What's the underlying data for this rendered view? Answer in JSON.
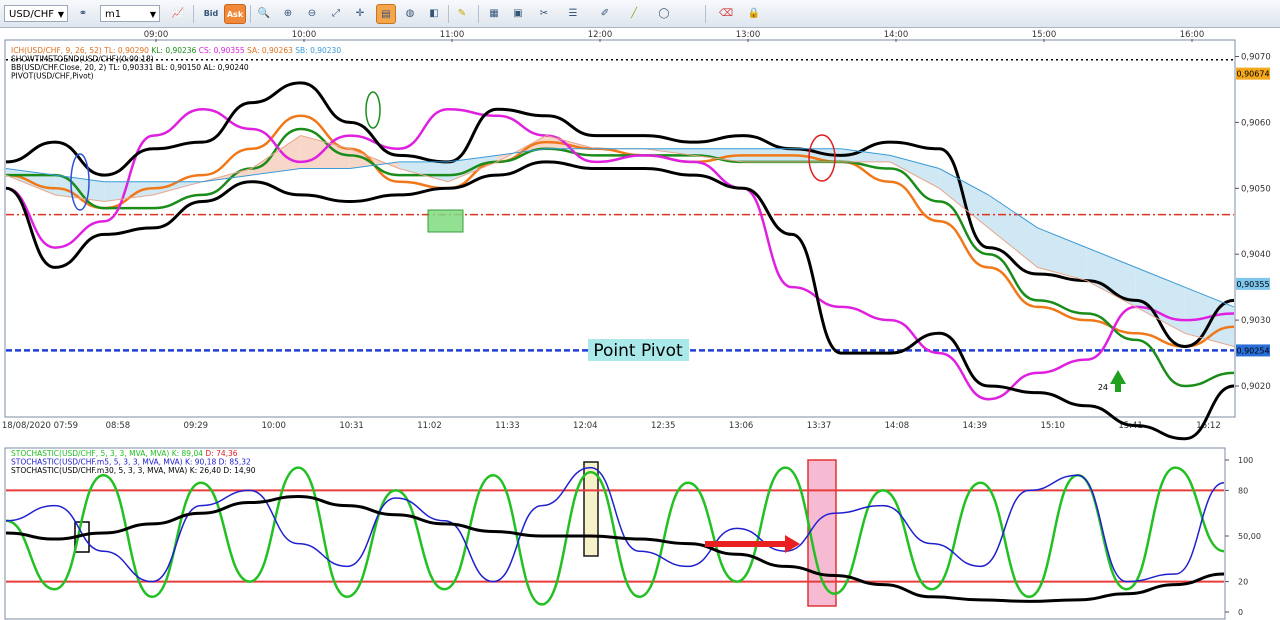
{
  "toolbar": {
    "symbol": "USD/CHF",
    "timeframe": "m1",
    "bid_label": "Bid",
    "ask_label": "Ask",
    "icons": [
      "link-icon",
      "chart-style-icon",
      "bid-ask-icon",
      "zoom-icon",
      "zoom-in-icon",
      "zoom-out-icon",
      "zoom-fit-icon",
      "crosshair-icon",
      "properties-icon",
      "globe-icon",
      "ruler-icon",
      "image-icon",
      "window-icon",
      "tools-icon",
      "lines-icon",
      "pen-icon",
      "line-icon",
      "ellipse-icon",
      "eraser-icon",
      "lock-icon"
    ]
  },
  "top_time_labels": [
    "09:00",
    "10:00",
    "11:00",
    "12:00",
    "13:00",
    "14:00",
    "15:00",
    "16:00"
  ],
  "bottom_time_labels": [
    "18/08/2020 07:59",
    "08:58",
    "09:29",
    "10:00",
    "10:31",
    "11:02",
    "11:33",
    "12:04",
    "12:35",
    "13:06",
    "13:37",
    "14:08",
    "14:39",
    "15:10",
    "15:41",
    "16:12"
  ],
  "price_labels": [
    "0,9070",
    "0,9060",
    "0,9050",
    "0,9040",
    "0,9030",
    "0,9020"
  ],
  "price_badges": [
    {
      "text": "0,90674",
      "color": "#f4a81c"
    },
    {
      "text": "0,90355",
      "color": "#7fc6ec"
    },
    {
      "text": "0,90254",
      "color": "#2a6fd8"
    }
  ],
  "indicator_legend": [
    {
      "segments": [
        {
          "text": "ICH(USD/CHF, 9, 26, 52)",
          "color": "#e07020"
        },
        {
          "text": "TL: 0,90290",
          "color": "#e07020"
        },
        {
          "text": "KL: 0,90236",
          "color": "#1a8c1a"
        },
        {
          "text": "CS: 0,90355",
          "color": "#e020e0"
        },
        {
          "text": "SA: 0,90263",
          "color": "#e07020"
        },
        {
          "text": "SB: 0,90230",
          "color": "#3a9ad6"
        }
      ]
    },
    {
      "segments": [
        {
          "text": "SHOWTIMETOEND(USD/CHF)(0:00:18)",
          "color": "#000000"
        }
      ]
    },
    {
      "segments": [
        {
          "text": "BB(USD/CHF.Close, 20, 2)  TL: 0,90331  BL: 0,90150  AL: 0,90240",
          "color": "#000000"
        }
      ]
    },
    {
      "segments": [
        {
          "text": "PIVOT(USD/CHF,Pivot)",
          "color": "#000000"
        }
      ]
    }
  ],
  "annotation_label": "Point Pivot",
  "arrow_label": "24",
  "stoch_legend": [
    {
      "segments": [
        {
          "text": "STOCHASTIC(USD/CHF, 5, 3, 3, MVA, MVA)",
          "color": "#22c022"
        },
        {
          "text": "K: 89,04",
          "color": "#22c022"
        },
        {
          "text": "D: 74,36",
          "color": "#e02020"
        }
      ]
    },
    {
      "segments": [
        {
          "text": "STOCHASTIC(USD/CHF.m5, 5, 3, 3, MVA, MVA)",
          "color": "#2020d0"
        },
        {
          "text": "K: 90,18",
          "color": "#2020d0"
        },
        {
          "text": "D: 85,32",
          "color": "#2020d0"
        }
      ]
    },
    {
      "segments": [
        {
          "text": "STOCHASTIC(USD/CHF.m30, 5, 3, 3, MVA, MVA)",
          "color": "#000000"
        },
        {
          "text": "K: 26,40",
          "color": "#000000"
        },
        {
          "text": "D: 14,90",
          "color": "#000000"
        }
      ]
    }
  ],
  "stoch_axis": [
    "100",
    "80",
    "50,00",
    "20",
    "0"
  ],
  "chart_data": {
    "type": "line",
    "symbol": "USD/CHF",
    "ylim": [
      0.90153,
      0.90725
    ],
    "x": [
      0,
      4,
      8,
      12,
      16,
      20,
      24,
      28,
      32,
      36,
      40,
      44,
      48,
      52,
      56,
      60,
      64,
      68,
      72,
      76,
      80,
      84,
      88,
      92,
      96,
      100
    ],
    "series": [
      {
        "name": "ICH TL",
        "color": "#f07818",
        "values": [
          0.9052,
          0.905,
          0.9047,
          0.905,
          0.9052,
          0.9056,
          0.9061,
          0.9056,
          0.9051,
          0.905,
          0.9054,
          0.9057,
          0.9056,
          0.9055,
          0.9054,
          0.9055,
          0.9055,
          0.9054,
          0.9051,
          0.9045,
          0.9038,
          0.9032,
          0.903,
          0.9028,
          0.9026,
          0.9029
        ]
      },
      {
        "name": "ICH KL",
        "color": "#1a8c1a",
        "values": [
          0.9052,
          0.9052,
          0.9047,
          0.9047,
          0.9049,
          0.9053,
          0.9059,
          0.9055,
          0.9052,
          0.9052,
          0.9054,
          0.9056,
          0.9055,
          0.9055,
          0.9055,
          0.9054,
          0.9054,
          0.9054,
          0.9053,
          0.9048,
          0.904,
          0.9033,
          0.9031,
          0.9027,
          0.902,
          0.9022
        ]
      },
      {
        "name": "ICH CS",
        "color": "#e020e0",
        "values": [
          0.905,
          0.9041,
          0.9045,
          0.9058,
          0.9062,
          0.9059,
          0.9054,
          0.9058,
          0.9056,
          0.9062,
          0.9061,
          0.9058,
          0.9054,
          0.9055,
          0.9054,
          0.905,
          0.9035,
          0.9032,
          0.903,
          0.9025,
          0.9018,
          0.9022,
          0.9024,
          0.9032,
          0.903,
          0.9031
        ]
      },
      {
        "name": "BB upper",
        "color": "#000000",
        "values": [
          0.9054,
          0.9057,
          0.9052,
          0.9056,
          0.9057,
          0.9063,
          0.9066,
          0.906,
          0.9055,
          0.9054,
          0.9062,
          0.9061,
          0.9058,
          0.9058,
          0.9057,
          0.9058,
          0.9056,
          0.9055,
          0.9057,
          0.9056,
          0.9041,
          0.9037,
          0.9036,
          0.9033,
          0.9026,
          0.9033
        ]
      },
      {
        "name": "BB lower",
        "color": "#000000",
        "values": [
          0.905,
          0.9038,
          0.9043,
          0.9044,
          0.9048,
          0.9051,
          0.9049,
          0.9048,
          0.9049,
          0.905,
          0.9052,
          0.9054,
          0.9053,
          0.9053,
          0.9052,
          0.905,
          0.9043,
          0.9025,
          0.9025,
          0.9028,
          0.902,
          0.9019,
          0.9017,
          0.9014,
          0.9012,
          0.902
        ]
      },
      {
        "name": "Senkou A",
        "color": "#e7a58a",
        "values": [
          0.9052,
          0.9049,
          0.9048,
          0.9049,
          0.9051,
          0.9053,
          0.9058,
          0.9056,
          0.9053,
          0.9051,
          0.9054,
          0.9058,
          0.9056,
          0.9056,
          0.9055,
          0.9054,
          0.9054,
          0.9054,
          0.9054,
          0.905,
          0.9044,
          0.9038,
          0.9036,
          0.9032,
          0.9028,
          0.9026
        ]
      },
      {
        "name": "Senkou B",
        "color": "#3a9ad6",
        "values": [
          0.9053,
          0.9052,
          0.9051,
          0.9051,
          0.9051,
          0.9052,
          0.9053,
          0.9053,
          0.9054,
          0.9054,
          0.9055,
          0.9056,
          0.9056,
          0.9056,
          0.9056,
          0.9056,
          0.9056,
          0.9056,
          0.9055,
          0.9053,
          0.9049,
          0.9044,
          0.9041,
          0.9038,
          0.9035,
          0.9032
        ]
      }
    ],
    "levels": [
      {
        "value": 0.90254,
        "color": "#1f3fd8",
        "style": "dashed"
      },
      {
        "value": 0.9046,
        "color": "#e03020",
        "style": "dashdot"
      },
      {
        "value": 0.90695,
        "color": "#000000",
        "style": "dotted"
      }
    ],
    "stochastic": {
      "ylim": [
        0,
        100
      ],
      "levels": [
        80,
        20
      ],
      "series": [
        {
          "name": "STOCHASTIC(USD/CHF, 5, 3, 3, MVA, MVA)",
          "color": "#22c022",
          "values": [
            60,
            15,
            90,
            10,
            85,
            20,
            95,
            10,
            80,
            15,
            90,
            5,
            92,
            10,
            85,
            20,
            95,
            12,
            80,
            15,
            85,
            10,
            90,
            15,
            95,
            40
          ]
        },
        {
          "name": "STOCHASTIC(USD/CHF.m5, 5, 3, 3, MVA, MVA)",
          "color": "#2020d0",
          "values": [
            60,
            70,
            40,
            20,
            70,
            80,
            45,
            30,
            75,
            60,
            20,
            70,
            95,
            40,
            30,
            55,
            40,
            65,
            70,
            45,
            30,
            80,
            90,
            20,
            25,
            85
          ]
        },
        {
          "name": "STOCHASTIC(USD/CHF.m30, 5, 3, 3, MVA, MVA)",
          "color": "#000000",
          "values": [
            52,
            48,
            52,
            58,
            65,
            72,
            76,
            70,
            64,
            58,
            53,
            50,
            50,
            48,
            45,
            38,
            30,
            24,
            18,
            10,
            8,
            7,
            8,
            12,
            18,
            25
          ]
        }
      ]
    }
  }
}
